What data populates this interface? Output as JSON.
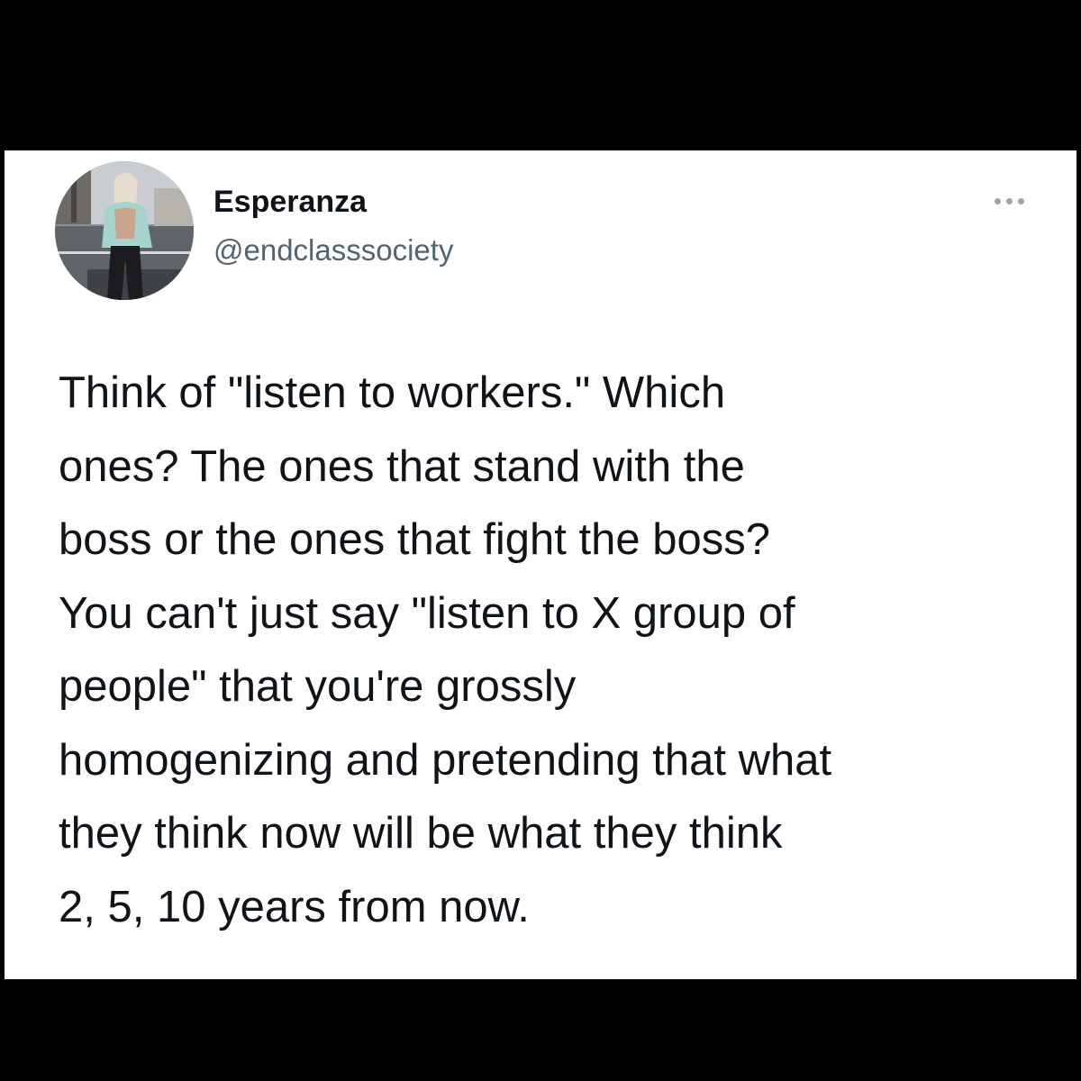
{
  "tweet": {
    "author": {
      "display_name": "Esperanza",
      "handle": "@endclasssociety"
    },
    "more_icon": "more-horizontal-icon",
    "text_lines": [
      "Think of \"listen to workers.\" Which",
      "ones? The ones that stand with the",
      "boss or the ones that fight the boss?",
      "You can't just say \"listen to X group of",
      "people\" that you're grossly",
      "homogenizing and pretending that what",
      "they think now will be what they think",
      "2, 5, 10 years from now."
    ]
  },
  "colors": {
    "background": "#000000",
    "card": "#ffffff",
    "primary_text": "#0f1419",
    "secondary_text": "#536471"
  }
}
